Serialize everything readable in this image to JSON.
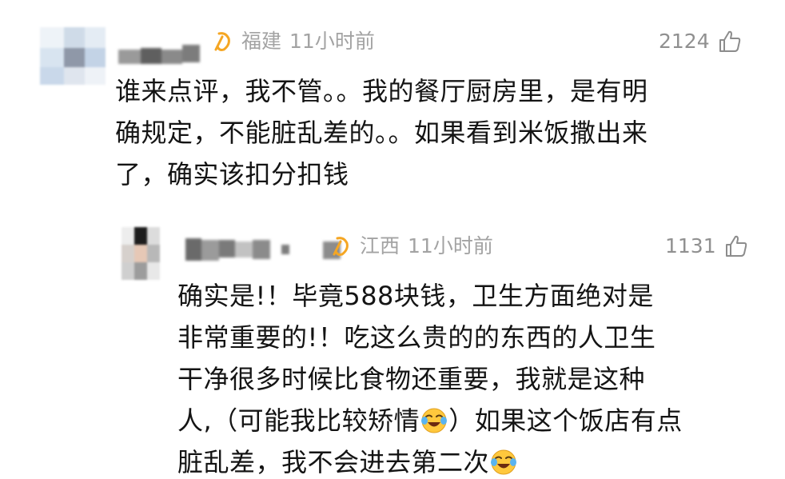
{
  "comments": [
    {
      "region": "福建",
      "time": "11小时前",
      "likes": "2124",
      "text_lines": [
        "谁来点评，我不管。。我的餐厅厨房里，是有明",
        "确规定，不能脏乱差的。。如果看到米饭撒出来",
        "了，确实该扣分扣钱"
      ]
    },
    {
      "region": "江西",
      "time": "11小时前",
      "likes": "1131",
      "text_lines": [
        "确实是!！毕竟588块钱，卫生方面绝对是",
        "非常重要的!！吃这么贵的的东西的人卫生",
        "干净很多时候比食物还重要，我就是这种"
      ],
      "line4_a": "人,（可能我比较矫情",
      "line4_b": "）如果这个饭店有点",
      "line5_a": "脏乱差，我不会进去第二次"
    }
  ],
  "icons": {
    "badge": "membership-badge-icon",
    "like": "thumbs-up-icon",
    "emoji": "laughing-crying-emoji-icon"
  },
  "colors": {
    "badge": "#f5a623",
    "meta": "#a3a3a3",
    "text": "#141414"
  }
}
